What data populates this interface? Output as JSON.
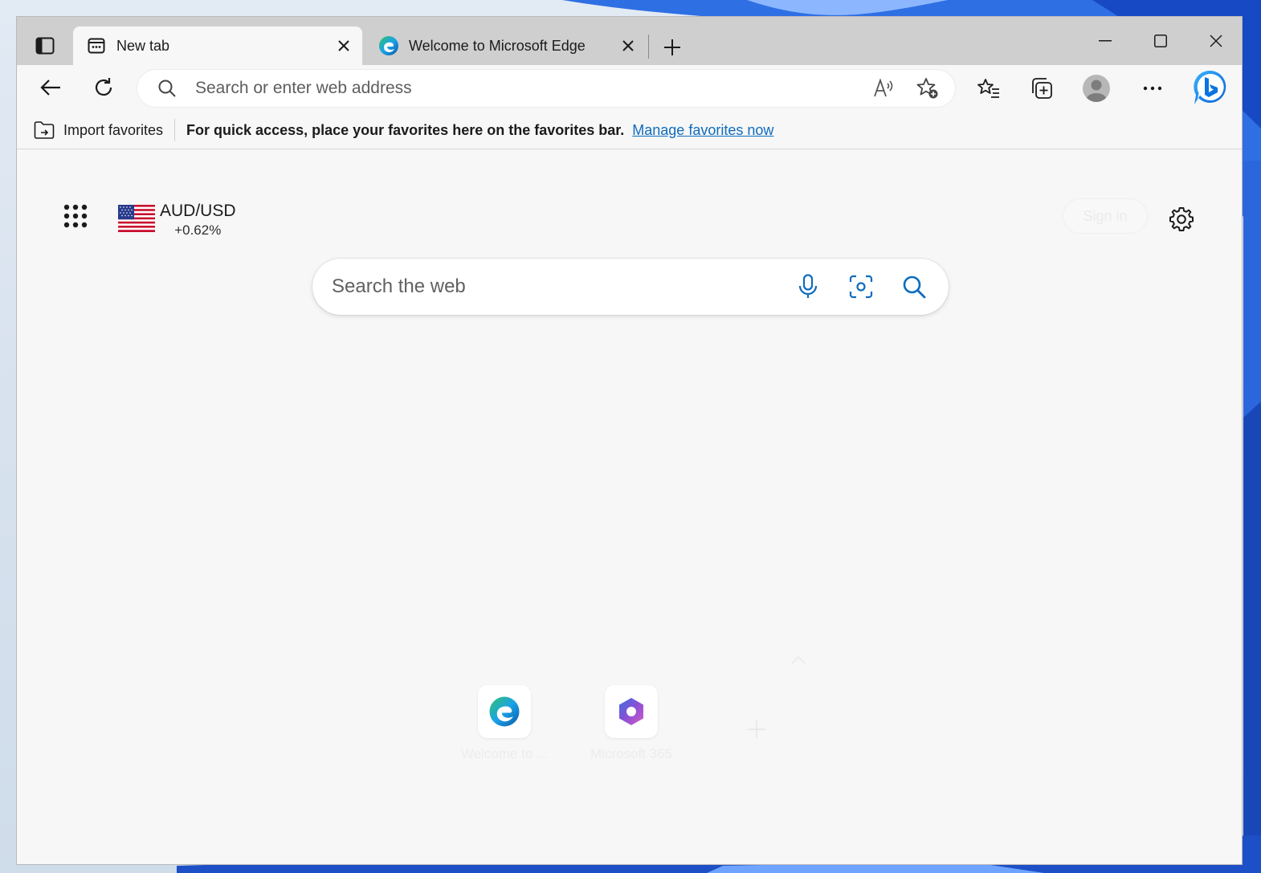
{
  "tabs": [
    {
      "title": "New tab",
      "active": true,
      "icon": "newtab-page-icon"
    },
    {
      "title": "Welcome to Microsoft Edge",
      "active": false,
      "icon": "edge-logo-icon"
    }
  ],
  "address_bar": {
    "placeholder": "Search or enter web address"
  },
  "favorites_bar": {
    "import_label": "Import favorites",
    "message": "For quick access, place your favorites here on the favorites bar.",
    "manage_link": "Manage favorites now"
  },
  "newtab": {
    "ticker": {
      "symbol": "AUD/USD",
      "change": "+0.62%"
    },
    "signin_label": "Sign in",
    "search_placeholder": "Search the web",
    "quick_links": [
      {
        "label": "Welcome to ...",
        "icon": "edge-logo-icon"
      },
      {
        "label": "Microsoft 365",
        "icon": "microsoft365-logo-icon"
      }
    ]
  },
  "colors": {
    "accent": "#0f6cbd",
    "titlebar": "#cfcfcf",
    "page": "#f7f7f7"
  }
}
